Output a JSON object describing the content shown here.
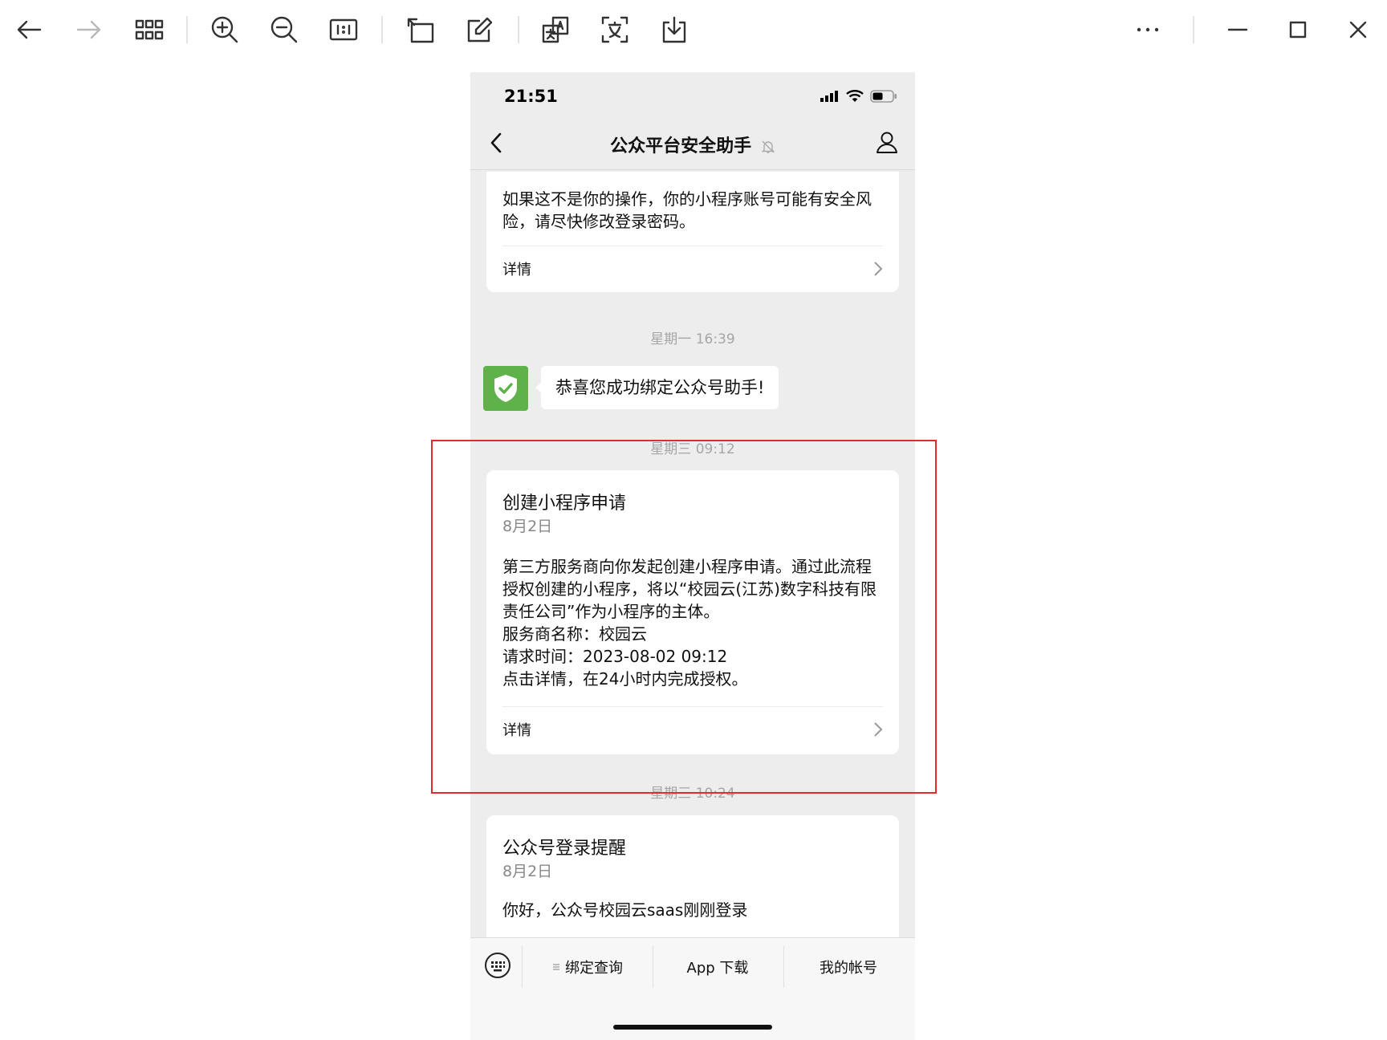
{
  "toolbar": {
    "icons": [
      "back-arrow-icon",
      "forward-arrow-icon",
      "grid-icon",
      "zoom-in-icon",
      "zoom-out-icon",
      "actual-size-icon",
      "rotate-icon",
      "edit-icon",
      "translate-icon",
      "ocr-text-icon",
      "download-icon",
      "more-icon",
      "minimize-icon",
      "maximize-icon",
      "close-icon"
    ],
    "actual_size_label": "1:1"
  },
  "phone": {
    "status_time": "21:51",
    "nav_title": "公众平台安全助手",
    "card1": {
      "body": "如果这不是你的操作，你的小程序账号可能有安全风险，请尽快修改登录密码。",
      "detail_label": "详情"
    },
    "time_label_1": "星期一 16:39",
    "bot_message": "恭喜您成功绑定公众号助手!",
    "time_label_2": "星期三 09:12",
    "card2": {
      "title": "创建小程序申请",
      "date": "8月2日",
      "body_lines": [
        "第三方服务商向你发起创建小程序申请。通过此流程授权创建的小程序，将以“校园云(江苏)数字科技有限责任公司”作为小程序的主体。",
        "服务商名称：校园云",
        "请求时间：2023-08-02 09:12",
        "点击详情，在24小时内完成授权。"
      ],
      "detail_label": "详情"
    },
    "time_label_3": "星期三 10:24",
    "card3": {
      "title": "公众号登录提醒",
      "date": "8月2日",
      "body": "你好，公众号校园云saas刚刚登录"
    },
    "menu": {
      "item1": "绑定查询",
      "item2": "App 下载",
      "item3": "我的帐号"
    }
  },
  "colors": {
    "highlight": "#e52a2a",
    "avatar_green": "#5fb14a",
    "chat_bg": "#ededed"
  }
}
